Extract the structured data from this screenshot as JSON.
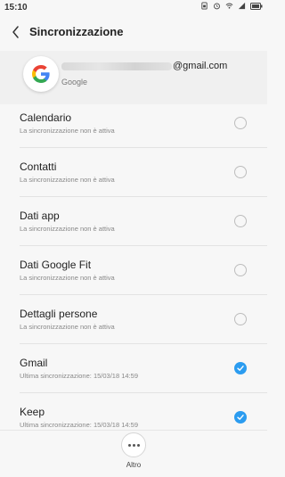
{
  "status_bar": {
    "time": "15:10",
    "icons": [
      "sim-icon",
      "alarm-icon",
      "wifi-icon",
      "signal-icon",
      "battery-icon"
    ]
  },
  "header": {
    "back_icon": "chevron-left-icon",
    "title": "Sincronizzazione"
  },
  "account": {
    "email_visible": "@gmail.com",
    "provider": "Google",
    "avatar_icon": "google-logo-icon"
  },
  "items": [
    {
      "name": "Calendario",
      "status": "La sincronizzazione non è attiva",
      "checked": false
    },
    {
      "name": "Contatti",
      "status": "La sincronizzazione non è attiva",
      "checked": false
    },
    {
      "name": "Dati app",
      "status": "La sincronizzazione non è attiva",
      "checked": false
    },
    {
      "name": "Dati Google Fit",
      "status": "La sincronizzazione non è attiva",
      "checked": false
    },
    {
      "name": "Dettagli persone",
      "status": "La sincronizzazione non è attiva",
      "checked": false
    },
    {
      "name": "Gmail",
      "status": "Ultima sincronizzazione: 15/03/18 14:59",
      "checked": true
    },
    {
      "name": "Keep",
      "status": "Ultima sincronizzazione: 15/03/18 14:59",
      "checked": true
    }
  ],
  "bottom_bar": {
    "more_label": "Altro",
    "more_icon": "more-dots-icon"
  },
  "colors": {
    "accent": "#2b9cf0",
    "background": "#f7f7f7",
    "account_bg": "#f0f0f0"
  }
}
